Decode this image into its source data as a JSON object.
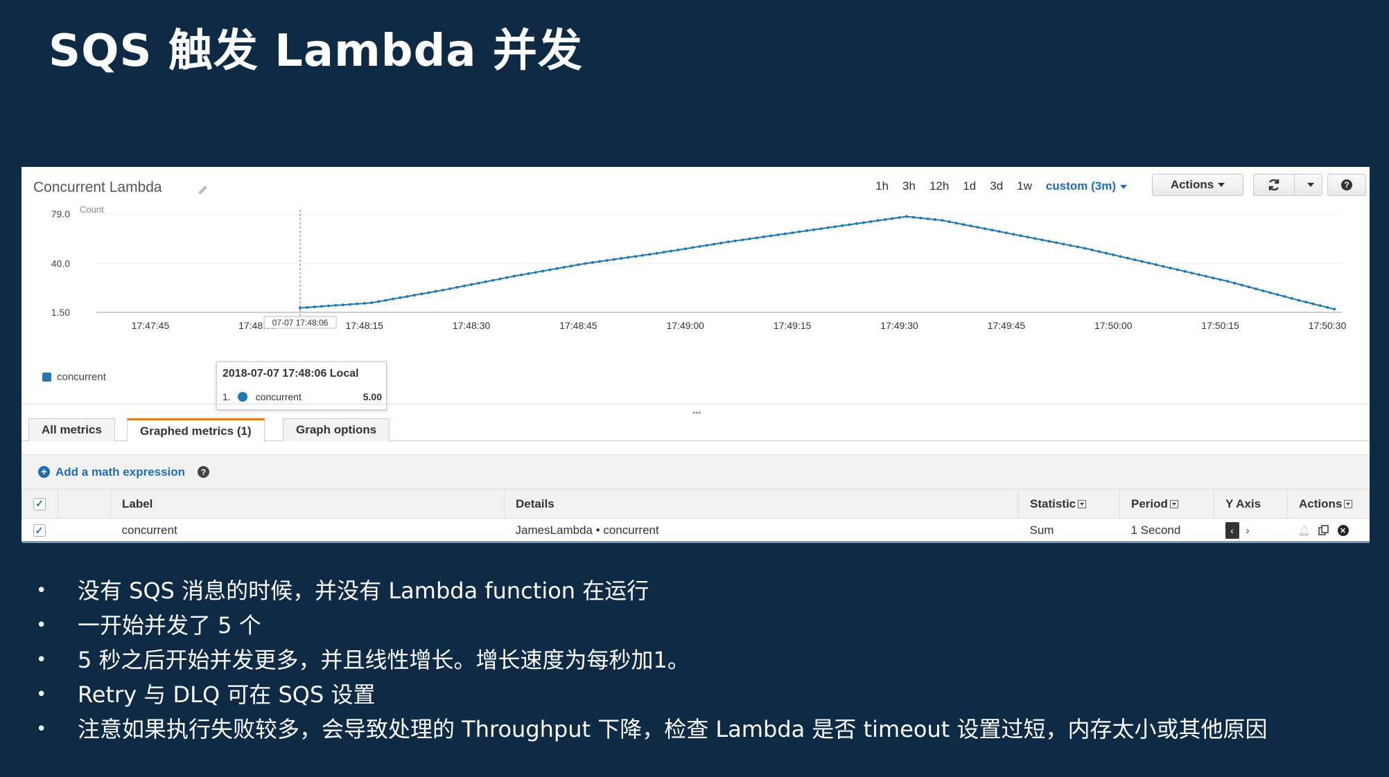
{
  "slide": {
    "title": "SQS 触发 Lambda 并发",
    "bullets": [
      "没有 SQS 消息的时候，并没有 Lambda function 在运行",
      "一开始并发了 5 个",
      "5 秒之后开始并发更多，并且线性增长。增长速度为每秒加1。",
      "Retry 与 DLQ 可在 SQS 设置",
      "注意如果执行失败较多，会导致处理的 Throughput 下降，检查 Lambda 是否 timeout 设置过短，内存太小或其他原因"
    ],
    "bullet_char": "•"
  },
  "cloudwatch": {
    "graph_title": "Concurrent Lambda",
    "time_ranges": [
      "1h",
      "3h",
      "12h",
      "1d",
      "3d",
      "1w"
    ],
    "custom_range": "custom (3m)",
    "actions_label": "Actions",
    "tabs": [
      "All metrics",
      "Graphed metrics (1)",
      "Graph options"
    ],
    "active_tab": 1,
    "math_expression_label": "Add a math expression",
    "table": {
      "headers": {
        "label": "Label",
        "details": "Details",
        "statistic": "Statistic",
        "period": "Period",
        "yaxis": "Y Axis",
        "actions": "Actions"
      },
      "rows": [
        {
          "label": "concurrent",
          "details": "JamesLambda • concurrent",
          "statistic": "Sum",
          "period": "1 Second"
        }
      ]
    },
    "tooltip": {
      "title": "2018-07-07 17:48:06 Local",
      "index": "1.",
      "series": "concurrent",
      "value": "5.00",
      "crosshair_label": "07-07 17:48:06"
    },
    "colors": {
      "series": "#1f77b4",
      "accent": "#1f6db3",
      "tab_active": "#e07b12",
      "slide_bg": "#0f2a44"
    }
  },
  "chart_data": {
    "type": "line",
    "ylabel": "Count",
    "y_ticks": [
      "79.0",
      "40.0",
      "1.50"
    ],
    "ylim": [
      1.5,
      79
    ],
    "x_ticks": [
      "17:47:45",
      "17:48:00",
      "17:48:15",
      "17:48:30",
      "17:48:45",
      "17:49:00",
      "17:49:15",
      "17:49:30",
      "17:49:45",
      "17:50:00",
      "17:50:15",
      "17:50:30"
    ],
    "x_tick_seconds": [
      45,
      60,
      75,
      90,
      105,
      120,
      135,
      150,
      165,
      180,
      195,
      210
    ],
    "legend": "top-left-below",
    "series": [
      {
        "name": "concurrent",
        "x_seconds": [
          66,
          76,
          86,
          96,
          106,
          116,
          126,
          136,
          146,
          151,
          156,
          166,
          176,
          186,
          196,
          206,
          211
        ],
        "y": [
          5,
          9,
          19,
          30,
          40,
          48,
          57,
          65,
          73,
          77,
          74,
          63,
          52,
          39,
          26,
          11,
          4
        ]
      }
    ]
  }
}
